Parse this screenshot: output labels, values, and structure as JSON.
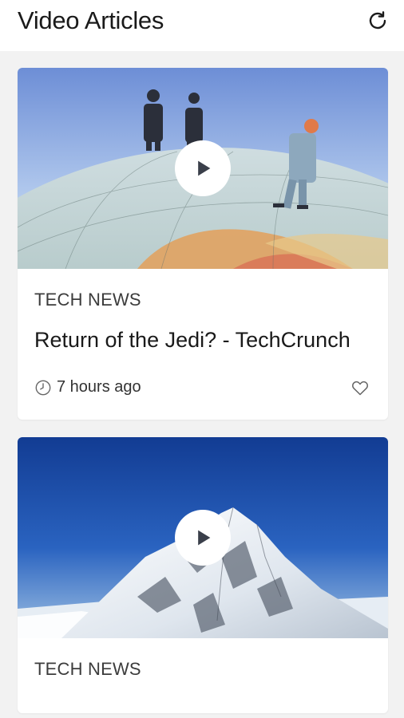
{
  "header": {
    "title": "Video Articles",
    "refresh_icon": "refresh-icon"
  },
  "articles": [
    {
      "category": "TECH NEWS",
      "title": "Return of the Jedi? - TechCrunch",
      "time": "7 hours ago",
      "thumbnail": "globe-businessmen-figurines",
      "play_icon": "play-icon",
      "like_icon": "heart-icon"
    },
    {
      "category": "TECH NEWS",
      "title": "",
      "time": "",
      "thumbnail": "snowy-mountain-peak",
      "play_icon": "play-icon",
      "like_icon": "heart-icon"
    }
  ],
  "colors": {
    "background": "#f2f2f2",
    "card": "#ffffff",
    "text_primary": "#1a1a1a",
    "text_secondary": "#3c3c3c",
    "icon": "#555555"
  }
}
